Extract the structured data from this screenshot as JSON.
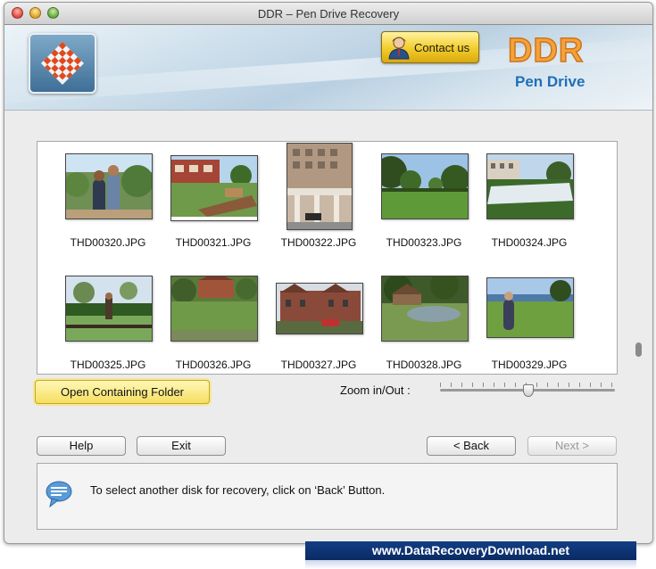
{
  "window": {
    "title": "DDR – Pen Drive Recovery"
  },
  "banner": {
    "contact_label": "Contact us",
    "brand_title": "DDR",
    "brand_subtitle": "Pen Drive"
  },
  "gallery": {
    "rows": [
      [
        {
          "name": "THD00320.JPG"
        },
        {
          "name": "THD00321.JPG"
        },
        {
          "name": "THD00322.JPG"
        },
        {
          "name": "THD00323.JPG"
        },
        {
          "name": "THD00324.JPG"
        }
      ],
      [
        {
          "name": "THD00325.JPG"
        },
        {
          "name": "THD00326.JPG"
        },
        {
          "name": "THD00327.JPG"
        },
        {
          "name": "THD00328.JPG"
        },
        {
          "name": "THD00329.JPG"
        }
      ]
    ]
  },
  "controls": {
    "open_folder_label": "Open Containing Folder",
    "zoom_label": "Zoom in/Out :",
    "zoom_level": 0.5
  },
  "buttons": {
    "help": "Help",
    "exit": "Exit",
    "back": "< Back",
    "next": "Next >"
  },
  "status": {
    "message": "To select another disk for recovery, click on ‘Back’ Button."
  },
  "footer": {
    "website": "www.DataRecoveryDownload.net"
  },
  "colors": {
    "brand_orange": "#f4a23a",
    "brand_blue": "#1f6fb8",
    "footer_navy": "#0b2a63"
  }
}
